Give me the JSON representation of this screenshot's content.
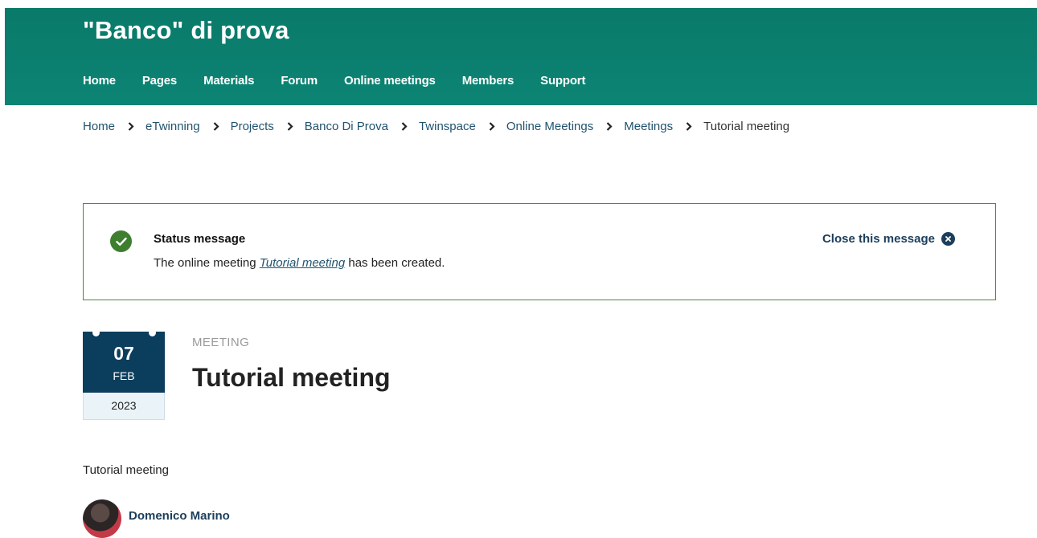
{
  "header": {
    "site_title": "\"Banco\" di prova",
    "nav": [
      "Home",
      "Pages",
      "Materials",
      "Forum",
      "Online meetings",
      "Members",
      "Support"
    ]
  },
  "breadcrumb": [
    "Home",
    "eTwinning",
    "Projects",
    "Banco Di Prova",
    "Twinspace",
    "Online Meetings",
    "Meetings",
    "Tutorial meeting"
  ],
  "status": {
    "title": "Status message",
    "text_before": "The online meeting ",
    "link": "Tutorial meeting",
    "text_after": " has been created.",
    "close_label": "Close this message",
    "icon": "check-circle-icon",
    "close_icon": "close-circle-icon"
  },
  "meeting": {
    "day": "07",
    "month": "FEB",
    "year": "2023",
    "label": "MEETING",
    "title": "Tutorial meeting",
    "description": "Tutorial meeting",
    "author": "Domenico Marino"
  },
  "colors": {
    "header_bg": "#0a7a6a",
    "link": "#21536e",
    "status_border": "#4b8a3e",
    "date_badge": "#0b3d5c"
  }
}
